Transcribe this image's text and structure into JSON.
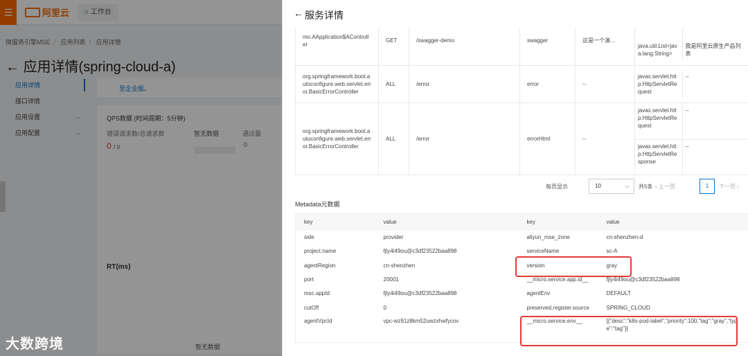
{
  "topbar": {
    "logo_text": "阿里云",
    "workbench": "工作台",
    "menu_icon": "menu-icon",
    "home_icon": "home-icon"
  },
  "breadcrumb": [
    "微服务引擎MSE",
    "应用列表",
    "应用详情"
  ],
  "page_title": "应用详情(spring-cloud-a)",
  "left_nav": [
    {
      "label": "应用详情",
      "active": true
    },
    {
      "label": "接口详情"
    },
    {
      "label": "应用设置",
      "expandable": true
    },
    {
      "label": "应用配置",
      "expandable": true
    }
  ],
  "bg_panel": {
    "upgrade_link": "至企业版。",
    "qps_title": "QPS数据 (时间周期：5分钟)",
    "err_label": "错误请求数/总请求数",
    "err_value": "0",
    "err_total": "/ 0",
    "nodata_1": "暂无数据",
    "pass_label": "通过量",
    "pass_value": "0",
    "rt_title": "RT(ms)",
    "nodata_2": "暂无数据"
  },
  "watermark": "大数跨境",
  "drawer": {
    "title": "服务详情",
    "api_rows": [
      {
        "class": "mo.AApplication$AController",
        "method": "GET",
        "path": "/swagger-demo",
        "name": "swagger",
        "desc": "这是一个演...",
        "params": [
          {
            "type": "java.util.List<java.lang.String>",
            "desc": "我是阿里云原生产品列表"
          }
        ]
      },
      {
        "class": "org.springframework.boot.autoconfigure.web.servlet.error.BasicErrorController",
        "method": "ALL",
        "path": "/error",
        "name": "error",
        "desc": "--",
        "params": [
          {
            "type": "javax.servlet.http.HttpServletRequest",
            "desc": "--"
          }
        ]
      },
      {
        "class": "org.springframework.boot.autoconfigure.web.servlet.error.BasicErrorController",
        "method": "ALL",
        "path": "/error",
        "name": "errorHtml",
        "desc": "--",
        "params": [
          {
            "type": "javax.servlet.http.HttpServletRequest",
            "desc": "--"
          },
          {
            "type": "javax.servlet.http.HttpServletResponse",
            "desc": "--"
          }
        ]
      }
    ],
    "pager": {
      "per_page_label": "每页显示",
      "per_page": "10",
      "total": "共5条",
      "prev": "上一页",
      "current": "1",
      "next": "下一页"
    },
    "meta_title": "Metadata元数据",
    "meta_headers": [
      "key",
      "value",
      "key",
      "value"
    ],
    "meta_rows": [
      [
        "side",
        "provider",
        "aliyun_mse_zone",
        "cn-shenzhen-d"
      ],
      [
        "project.name",
        "fjly4i49ou@c3df23522baa898",
        "serviceName",
        "sc-A"
      ],
      [
        "agentRegion",
        "cn-shenzhen",
        "version",
        "gray"
      ],
      [
        "port",
        "20001",
        "__micro.service.app.id__",
        "fjly4i49ou@c3df23522baa898"
      ],
      [
        "msc.appId",
        "fjly4i49ou@c3df23522baa898",
        "agentEnv",
        "DEFAULT"
      ],
      [
        "cutOff",
        "0",
        "preserved.register.source",
        "SPRING_CLOUD"
      ],
      [
        "agentVpcId",
        "vpc-wz91z8km52uwzxhwfycov",
        "__micro.service.env__",
        "[{\"desc\":\"k8s-pod-label\",\"priority\":100,\"tag\":\"gray\",\"type\":\"tag\"}]"
      ]
    ],
    "highlight_color": "#e53935"
  }
}
